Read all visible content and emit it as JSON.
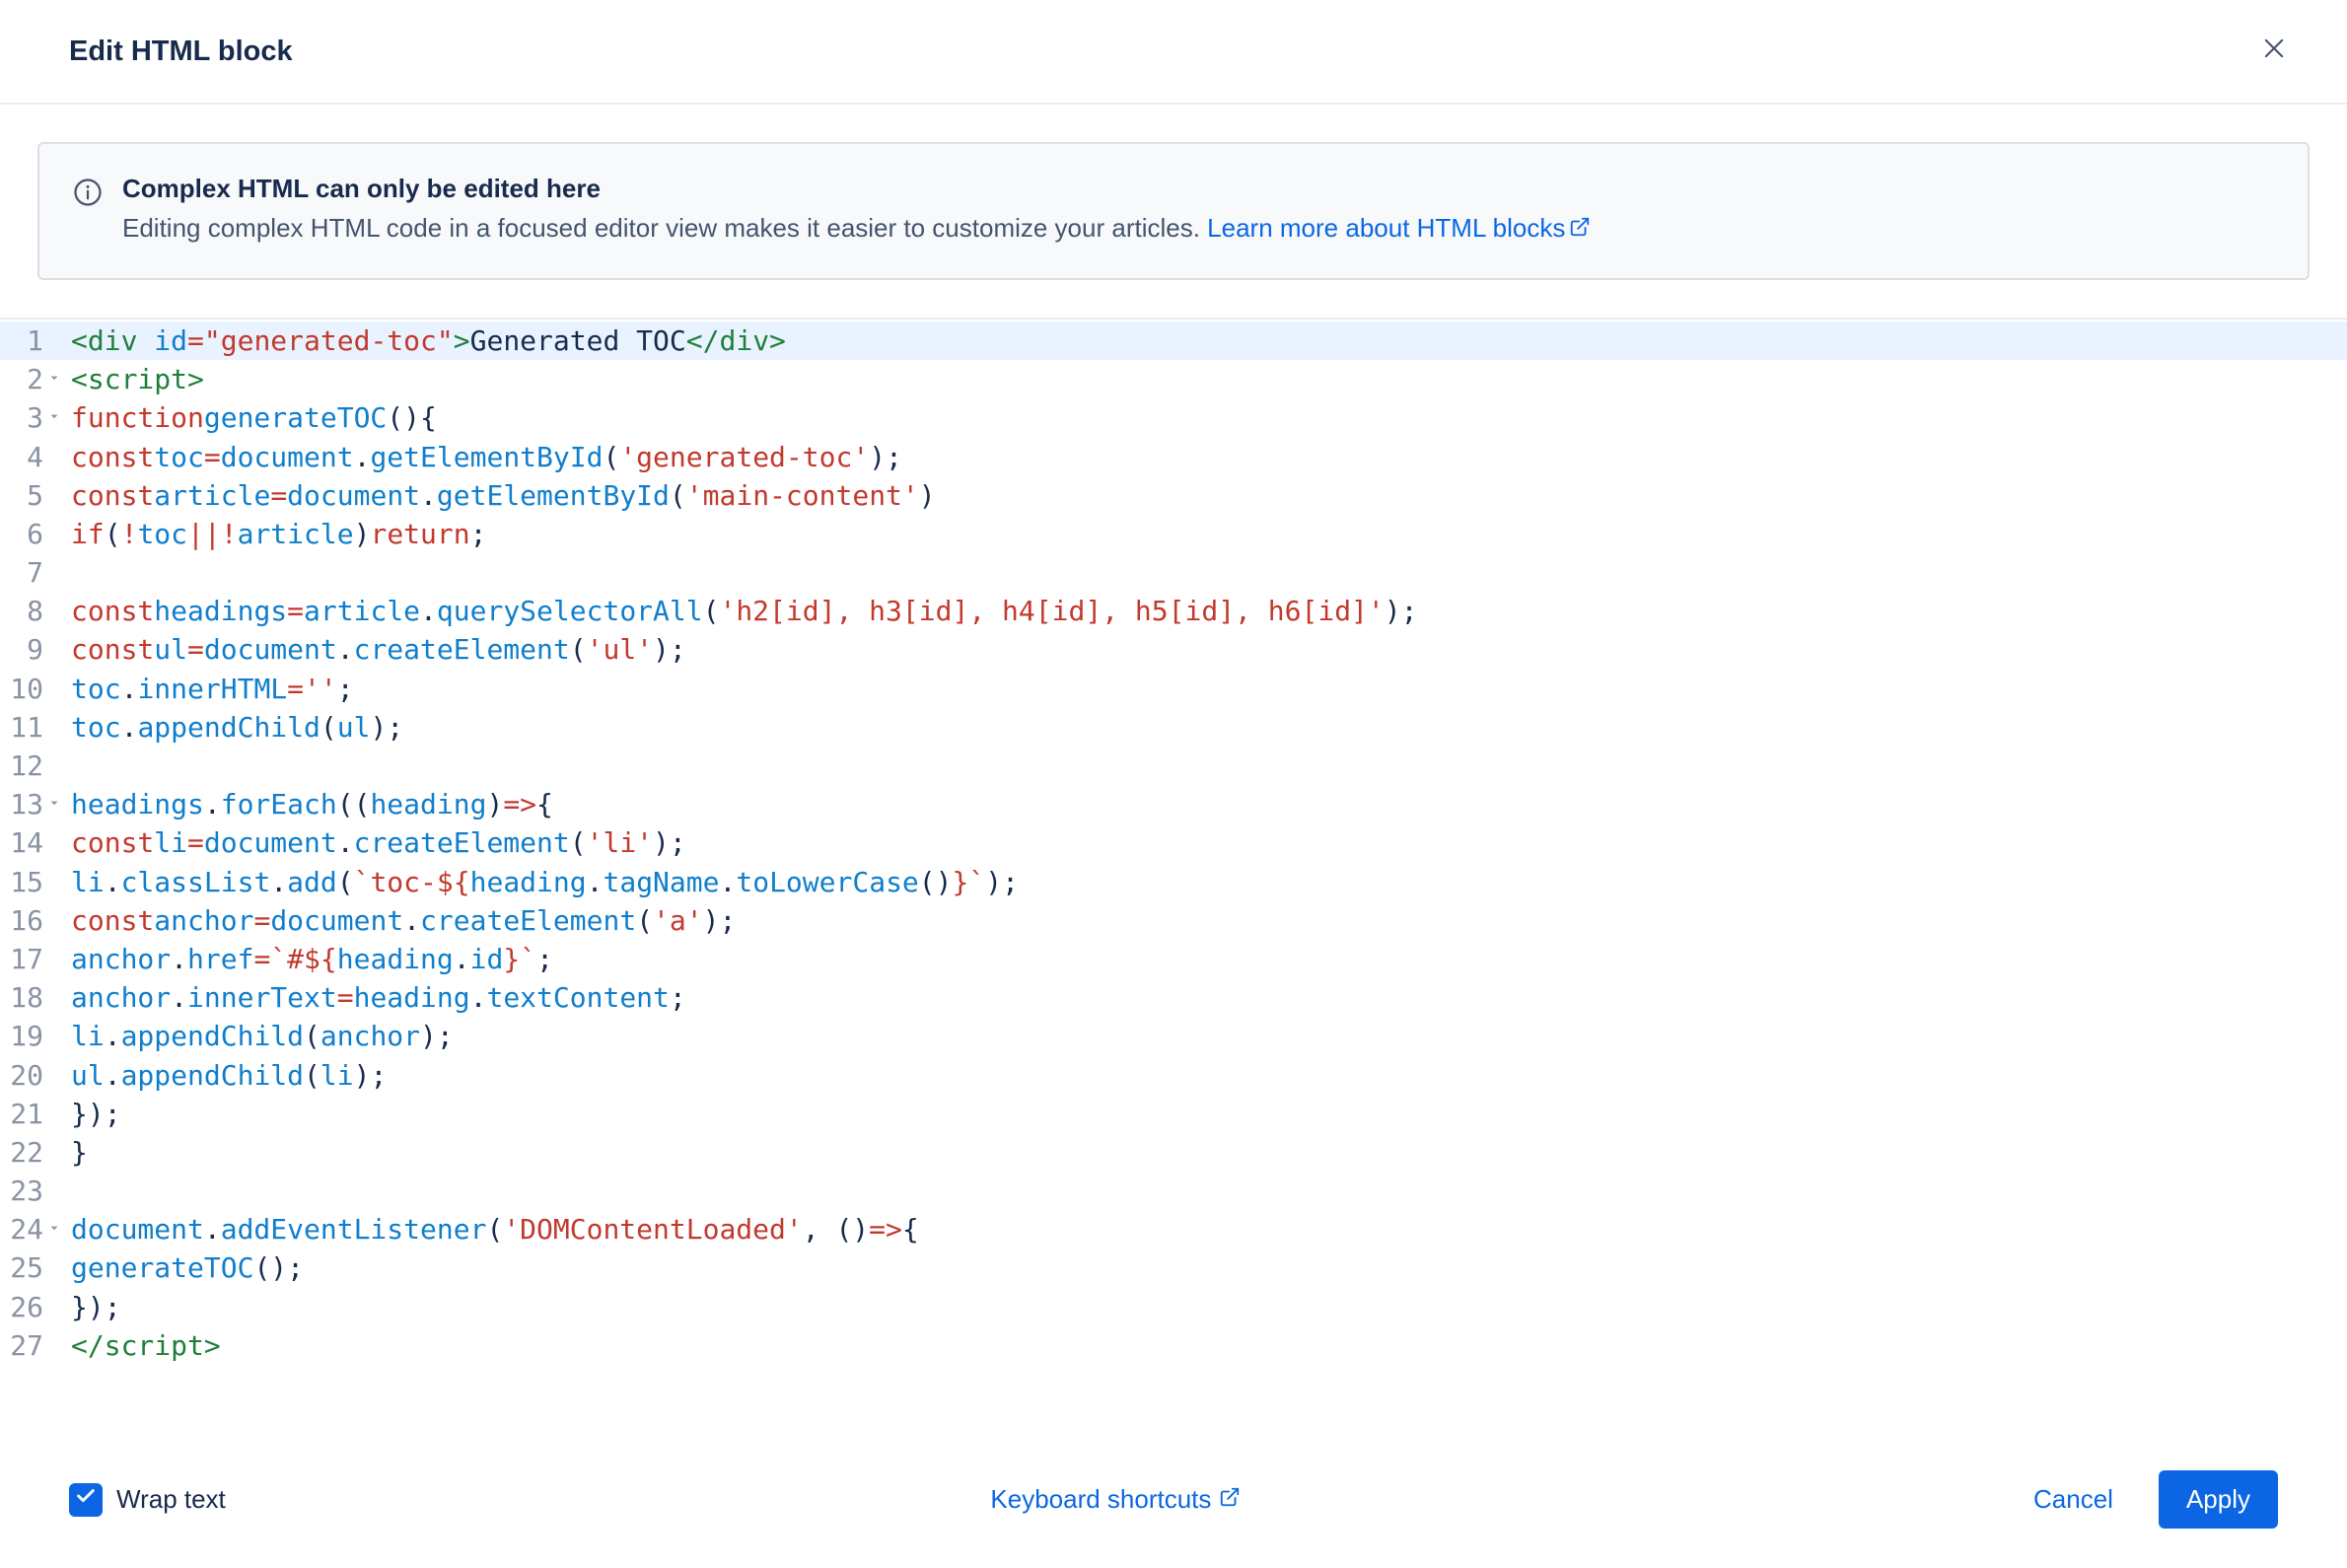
{
  "header": {
    "title": "Edit HTML block"
  },
  "banner": {
    "title": "Complex HTML can only be edited here",
    "desc": "Editing complex HTML code in a focused editor view makes it easier to customize your articles. ",
    "link": "Learn more about HTML blocks"
  },
  "editor": {
    "line_count": 27,
    "fold_lines": [
      2,
      3,
      13,
      24
    ],
    "current_line": 1,
    "lines_raw": [
      "<div id=\"generated-toc\">Generated TOC</div>",
      "<script>",
      "  function generateTOC() {",
      "    const toc = document.getElementById('generated-toc');",
      "    const article = document.getElementById('main-content')",
      "    if (!toc || !article) return;",
      "",
      "    const headings = article.querySelectorAll('h2[id], h3[id], h4[id], h5[id], h6[id]');",
      "    const ul = document.createElement('ul');",
      "    toc.innerHTML = '';",
      "    toc.appendChild(ul);",
      "",
      "    headings.forEach((heading) => {",
      "      const li = document.createElement('li');",
      "      li.classList.add(`toc-${heading.tagName.toLowerCase()}`);",
      "      const anchor = document.createElement('a');",
      "      anchor.href = `#${heading.id}`;",
      "      anchor.innerText = heading.textContent;",
      "      li.appendChild(anchor);",
      "      ul.appendChild(li);",
      "    });",
      "  }",
      "",
      "  document.addEventListener('DOMContentLoaded', () => {",
      "    generateTOC();",
      "  });",
      "</script>"
    ]
  },
  "footer": {
    "wrap_label": "Wrap text",
    "wrap_checked": true,
    "keyboard_shortcuts": "Keyboard shortcuts",
    "cancel": "Cancel",
    "apply": "Apply"
  }
}
